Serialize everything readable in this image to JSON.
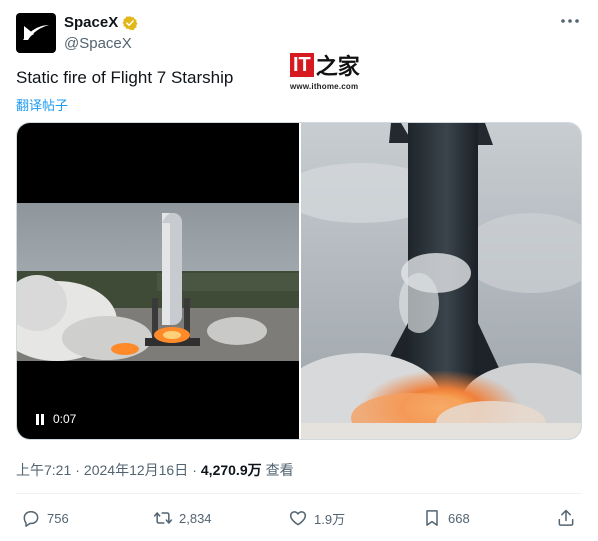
{
  "author": {
    "display_name": "SpaceX",
    "handle": "@SpaceX",
    "verified": true,
    "avatar_icon": "spacex-logo-icon"
  },
  "watermark": {
    "logo_text": "IT",
    "logo_char": "之家",
    "url": "www.ithome.com"
  },
  "tweet": {
    "text": "Static fire of Flight 7 Starship",
    "translate_label": "翻译帖子"
  },
  "media": {
    "video": {
      "timestamp": "0:07",
      "state_icon": "pause-icon"
    },
    "photo": {
      "subject": "starship-static-fire"
    }
  },
  "meta": {
    "time": "上午7:21",
    "separator": "·",
    "date": "2024年12月16日",
    "separator2": "·",
    "views": "4,270.9万",
    "views_label": "查看"
  },
  "actions": {
    "replies": "756",
    "reposts": "2,834",
    "likes": "1.9万",
    "bookmarks": "668"
  },
  "colors": {
    "accent": "#1d9bf0",
    "verified_gold": "#e2b719",
    "text_secondary": "#536471"
  }
}
